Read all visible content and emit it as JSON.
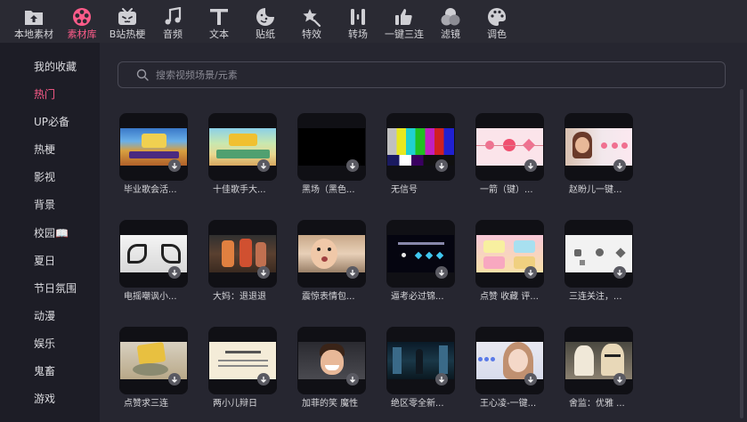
{
  "toolbar": {
    "items": [
      {
        "label": "本地素材",
        "icon": "upload-folder-icon",
        "active": false
      },
      {
        "label": "素材库",
        "icon": "film-reel-icon",
        "active": true
      },
      {
        "label": "B站热梗",
        "icon": "bilibili-tv-icon",
        "active": false
      },
      {
        "label": "音频",
        "icon": "music-note-icon",
        "active": false
      },
      {
        "label": "文本",
        "icon": "text-t-icon",
        "active": false
      },
      {
        "label": "贴纸",
        "icon": "sticker-smile-icon",
        "active": false
      },
      {
        "label": "特效",
        "icon": "magic-star-icon",
        "active": false
      },
      {
        "label": "转场",
        "icon": "transition-bars-icon",
        "active": false
      },
      {
        "label": "一键三连",
        "icon": "thumbs-up-icon",
        "active": false
      },
      {
        "label": "滤镜",
        "icon": "filter-circles-icon",
        "active": false
      },
      {
        "label": "调色",
        "icon": "palette-icon",
        "active": false
      }
    ]
  },
  "sidebar": {
    "items": [
      {
        "label": "我的收藏",
        "active": false
      },
      {
        "label": "热门",
        "active": true
      },
      {
        "label": "UP必备",
        "active": false
      },
      {
        "label": "热梗",
        "active": false
      },
      {
        "label": "影视",
        "active": false
      },
      {
        "label": "背景",
        "active": false
      },
      {
        "label": "校园📖",
        "active": false
      },
      {
        "label": "夏日",
        "active": false
      },
      {
        "label": "节日氛围",
        "active": false
      },
      {
        "label": "动漫",
        "active": false
      },
      {
        "label": "娱乐",
        "active": false
      },
      {
        "label": "鬼畜",
        "active": false
      },
      {
        "label": "游戏",
        "active": false
      }
    ]
  },
  "search": {
    "placeholder": "搜索视频场景/元素"
  },
  "materials": [
    [
      {
        "name": "毕业歌会活..."
      },
      {
        "name": "十佳歌手大..."
      },
      {
        "name": "黑场（黑色..."
      },
      {
        "name": "无信号"
      },
      {
        "name": "一箭（键）..."
      },
      {
        "name": "赵盼儿一键..."
      }
    ],
    [
      {
        "name": "电摇嘲讽小..."
      },
      {
        "name": "大妈：退退退"
      },
      {
        "name": "震惊表情包..."
      },
      {
        "name": "逼考必过锦..."
      },
      {
        "name": "点赞 收藏 评..."
      },
      {
        "name": "三连关注，..."
      }
    ],
    [
      {
        "name": "点赞求三连"
      },
      {
        "name": "两小儿辩日"
      },
      {
        "name": "加菲的笑 魔性"
      },
      {
        "name": "绝区零全新..."
      },
      {
        "name": "王心凌-一键..."
      },
      {
        "name": "舍监：优雅 ..."
      }
    ]
  ],
  "colors": {
    "accent": "#ff5c8a",
    "toolbar_bg": "#2a2a33",
    "sidebar_bg": "#1d1d26",
    "main_bg": "#262630"
  }
}
